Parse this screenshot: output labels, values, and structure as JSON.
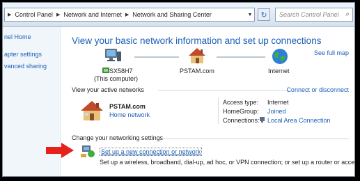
{
  "address_bar": {
    "crumbs": [
      "Control Panel",
      "Network and Internet",
      "Network and Sharing Center"
    ],
    "search_placeholder": "Search Control Panel"
  },
  "left_pane": {
    "items": [
      "nel Home",
      "apter settings",
      "vanced sharing"
    ]
  },
  "main": {
    "title": "View your basic network information and set up connections",
    "see_full_map": "See full map",
    "map": {
      "computer_name": "SX58H7",
      "computer_sub": "(This computer)",
      "network_name": "PSTAM.com",
      "internet_label": "Internet"
    },
    "active_networks": {
      "heading": "View your active networks",
      "connect_link": "Connect or disconnect",
      "network_name": "PSTAM.com",
      "network_type": "Home network",
      "access_type_label": "Access type:",
      "access_type_value": "Internet",
      "homegroup_label": "HomeGroup:",
      "homegroup_value": "Joined",
      "connections_label": "Connections:",
      "connections_value": "Local Area Connection"
    },
    "change_settings": {
      "heading": "Change your networking settings",
      "setup_link": "Set up a new connection or network",
      "setup_desc": "Set up a wireless, broadband, dial-up, ad hoc, or VPN connection; or set up a router or access point."
    }
  },
  "annotation": {
    "arrow_color": "#e8201a"
  }
}
